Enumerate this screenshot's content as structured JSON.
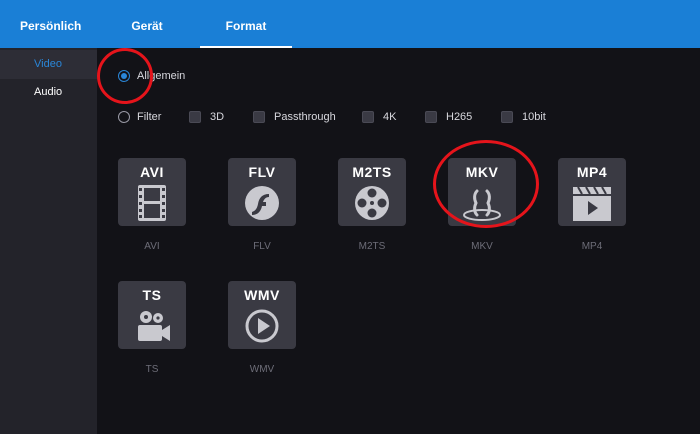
{
  "tabs": {
    "personal": "Persönlich",
    "device": "Gerät",
    "format": "Format"
  },
  "sidebar": {
    "items": [
      {
        "label": "Video"
      },
      {
        "label": "Audio"
      }
    ]
  },
  "options": {
    "general_label": "Allgemein",
    "filter_label": "Filter",
    "checkboxes": [
      {
        "label": "3D"
      },
      {
        "label": "Passthrough"
      },
      {
        "label": "4K"
      },
      {
        "label": "H265"
      },
      {
        "label": "10bit"
      }
    ]
  },
  "formats": [
    {
      "name": "AVI",
      "caption": "AVI",
      "icon": "film-strip-icon"
    },
    {
      "name": "FLV",
      "caption": "FLV",
      "icon": "flash-icon"
    },
    {
      "name": "M2TS",
      "caption": "M2TS",
      "icon": "film-reel-icon"
    },
    {
      "name": "MKV",
      "caption": "MKV",
      "icon": "matroska-icon"
    },
    {
      "name": "MP4",
      "caption": "MP4",
      "icon": "clapperboard-icon"
    },
    {
      "name": "TS",
      "caption": "TS",
      "icon": "video-camera-icon"
    },
    {
      "name": "WMV",
      "caption": "WMV",
      "icon": "play-circle-icon"
    }
  ],
  "colors": {
    "header": "#1a7fd6",
    "accent": "#2a86d8",
    "annotation": "#e5141b"
  }
}
